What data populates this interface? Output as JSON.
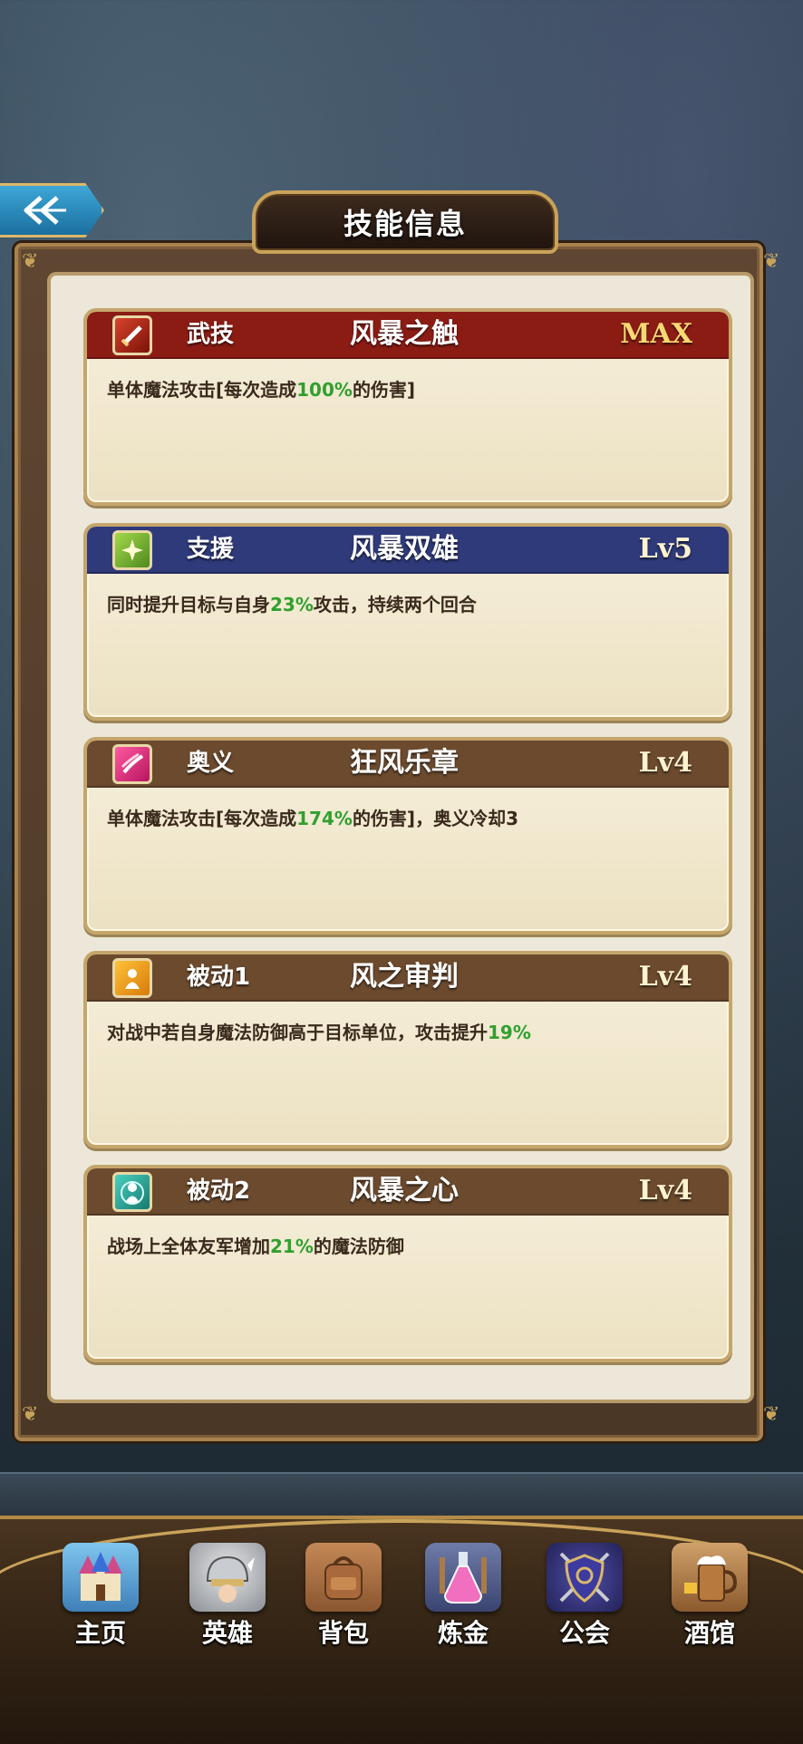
{
  "header": {
    "title": "技能信息",
    "back_icon": "double-chevron-left-icon"
  },
  "skills": [
    {
      "type": "武技",
      "name": "风暴之触",
      "level": "MAX",
      "header_color": "#8a1c14",
      "icon": "sword-icon",
      "desc_before": "单体魔法攻击[每次造成",
      "desc_value": "100%",
      "desc_after": "的伤害]"
    },
    {
      "type": "支援",
      "name": "风暴双雄",
      "level": "Lv5",
      "header_color": "#2f3a7a",
      "icon": "sparkle-icon",
      "desc_before": "同时提升目标与自身",
      "desc_value": "23%",
      "desc_after": "攻击，持续两个回合"
    },
    {
      "type": "奥义",
      "name": "狂风乐章",
      "level": "Lv4",
      "header_color": "#6b4a2e",
      "icon": "wind-slash-icon",
      "desc_before": "单体魔法攻击[每次造成",
      "desc_value": "174%",
      "desc_after": "的伤害]，奥义冷却3"
    },
    {
      "type": "被动1",
      "name": "风之审判",
      "level": "Lv4",
      "header_color": "#6b4a2e",
      "icon": "person-glow-icon",
      "desc_before": "对战中若自身魔法防御高于目标单位，攻击提升",
      "desc_value": "19%",
      "desc_after": ""
    },
    {
      "type": "被动2",
      "name": "风暴之心",
      "level": "Lv4",
      "header_color": "#6b4a2e",
      "icon": "person-aura-icon",
      "desc_before": "战场上全体友军增加",
      "desc_value": "21%",
      "desc_after": "的魔法防御"
    }
  ],
  "nav": [
    {
      "label": "主页",
      "icon": "castle-icon"
    },
    {
      "label": "英雄",
      "icon": "helmet-icon"
    },
    {
      "label": "背包",
      "icon": "backpack-icon"
    },
    {
      "label": "炼金",
      "icon": "potion-icon"
    },
    {
      "label": "公会",
      "icon": "guild-shield-icon"
    },
    {
      "label": "酒馆",
      "icon": "tavern-mug-icon"
    }
  ],
  "colors": {
    "highlight_green": "#2fa02f",
    "gold": "#c9a35a"
  }
}
